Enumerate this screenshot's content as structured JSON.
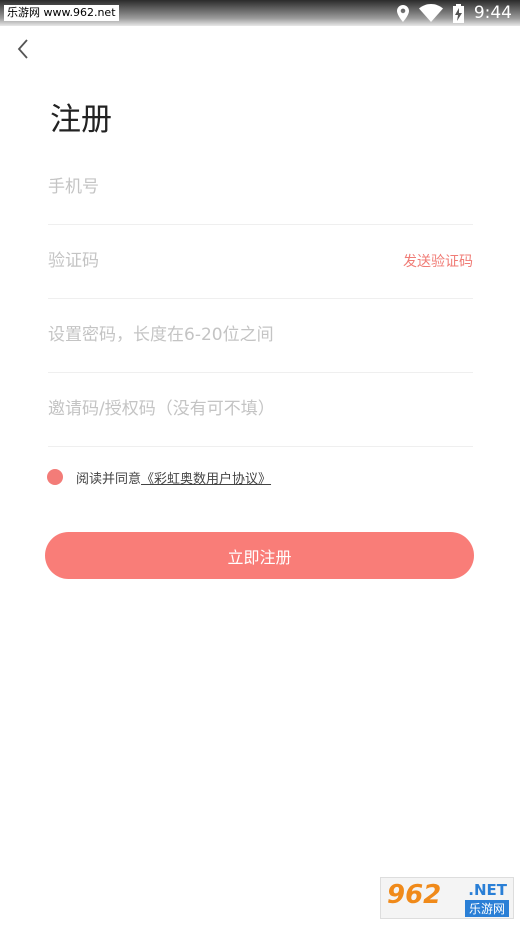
{
  "status_bar": {
    "site_watermark": "乐游网 www.962.net",
    "time": "9:44"
  },
  "page": {
    "title": "注册"
  },
  "form": {
    "phone_placeholder": "手机号",
    "code_placeholder": "验证码",
    "send_code_label": "发送验证码",
    "password_placeholder": "设置密码，长度在6-20位之间",
    "invite_placeholder": "邀请码/授权码（没有可不填）"
  },
  "agreement": {
    "prefix": "阅读并同意",
    "link": "《彩虹奥数用户协议》"
  },
  "register_button": "立即注册",
  "corner_watermark": {
    "number": "962",
    "suffix": ".NET",
    "cn": "乐游网"
  },
  "colors": {
    "accent": "#f97d78",
    "link": "#f07c76",
    "radio": "#f37c78"
  }
}
